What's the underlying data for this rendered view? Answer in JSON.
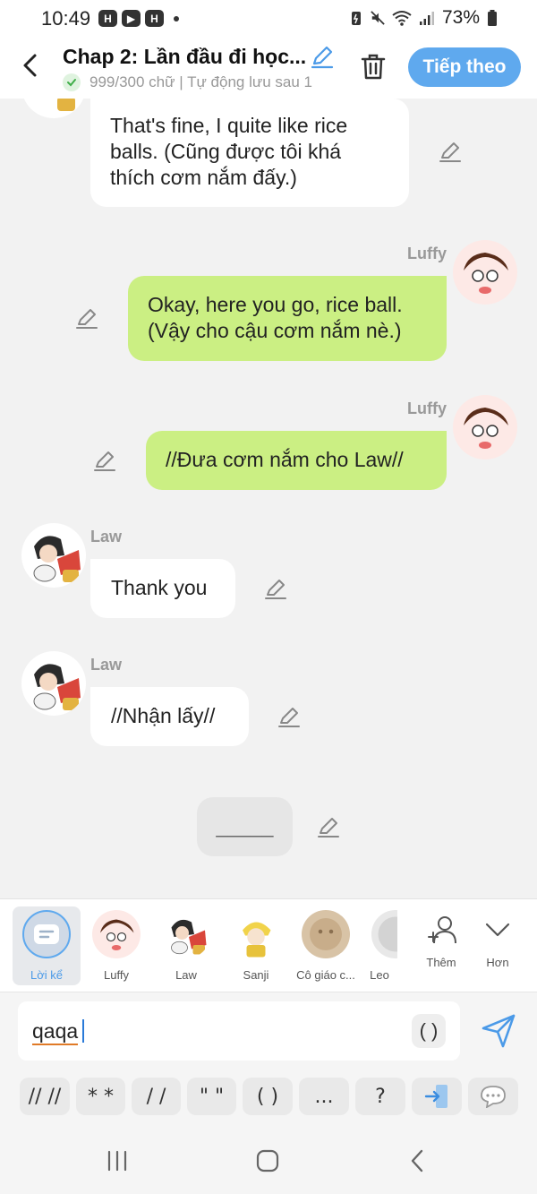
{
  "status_bar": {
    "time": "10:49",
    "app_icons": [
      "H",
      "▶",
      "H"
    ],
    "battery": "73%"
  },
  "header": {
    "title": "Chap 2: Lần đầu đi học...",
    "subtitle": "999/300 chữ | Tự động lưu sau 1",
    "next_label": "Tiếp theo"
  },
  "messages": [
    {
      "side": "left",
      "sender": "",
      "text_lines": [
        "That's fine, I quite like rice",
        "balls. (Cũng được tôi khá",
        "thích cơm nắm đấy.)"
      ]
    },
    {
      "side": "right",
      "sender": "Luffy",
      "text_lines": [
        "Okay, here you go, rice ball.",
        "(Vậy cho cậu cơm nắm nè.)"
      ]
    },
    {
      "side": "right",
      "sender": "Luffy",
      "text_lines": [
        "//Đưa cơm nắm cho Law//"
      ]
    },
    {
      "side": "left",
      "sender": "Law",
      "text_lines": [
        "Thank you"
      ]
    },
    {
      "side": "left",
      "sender": "Law",
      "text_lines": [
        "//Nhận lấy//"
      ]
    },
    {
      "side": "center",
      "sender": "",
      "text_lines": [
        "_____"
      ]
    }
  ],
  "characters": [
    {
      "label": "Lời kể",
      "icon": "narration-icon"
    },
    {
      "label": "Luffy",
      "icon": "luffy-avatar"
    },
    {
      "label": "Law",
      "icon": "law-avatar"
    },
    {
      "label": "Sanji",
      "icon": "sanji-avatar"
    },
    {
      "label": "Cô giáo c...",
      "icon": "teacher-avatar"
    },
    {
      "label": "Leo",
      "icon": "leo-avatar"
    },
    {
      "label": "Thêm",
      "icon": "add-user-icon"
    },
    {
      "label": "Hơn",
      "icon": "chevron-down-icon"
    }
  ],
  "input": {
    "value": "qaqa",
    "paren_label": "( )"
  },
  "shortcuts": [
    "// //",
    "* *",
    "/ /",
    "\" \"",
    "( )",
    "...",
    "?",
    "",
    ""
  ],
  "colors": {
    "accent": "#5fa9ee",
    "green_bubble": "#cbef83",
    "white_bubble": "#ffffff",
    "background": "#f2f2f2"
  }
}
